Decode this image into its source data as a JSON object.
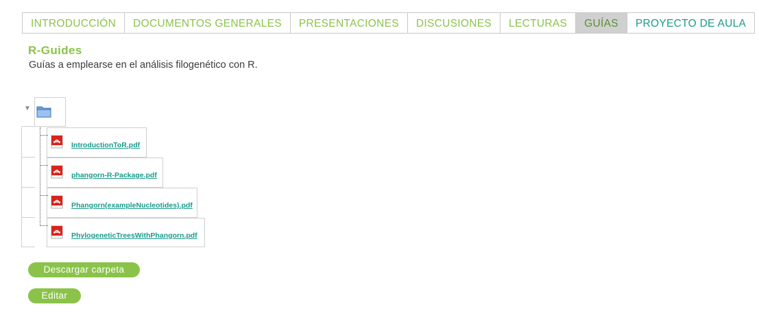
{
  "tabs": [
    {
      "label": "INTRODUCCIÓN"
    },
    {
      "label": "DOCUMENTOS GENERALES"
    },
    {
      "label": "PRESENTACIONES"
    },
    {
      "label": "DISCUSIONES"
    },
    {
      "label": "LECTURAS"
    },
    {
      "label": "GUÍAS"
    },
    {
      "label": "PROYECTO DE AULA"
    }
  ],
  "active_tab": "GUÍAS",
  "page": {
    "title": "R-Guides",
    "description": "Guías a emplearse en el análisis filogenético con R."
  },
  "tree": {
    "folder_icon": "folder-icon",
    "files": [
      {
        "name": "IntroductionToR.pdf",
        "icon": "pdf-icon"
      },
      {
        "name": "phangorn-R-Package.pdf",
        "icon": "pdf-icon"
      },
      {
        "name": "Phangorn(exampleNucleotides).pdf",
        "icon": "pdf-icon"
      },
      {
        "name": "PhylogeneticTreesWithPhangorn.pdf",
        "icon": "pdf-icon"
      }
    ]
  },
  "buttons": {
    "download_label": "Descargar carpeta",
    "edit_label": "Editar"
  },
  "colors": {
    "accent_green": "#8bc34a",
    "link_teal": "#1a9a8a",
    "active_tab_bg": "#cfd0cf"
  }
}
